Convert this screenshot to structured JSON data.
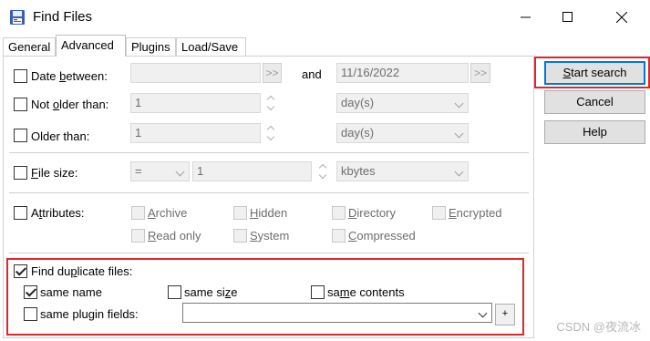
{
  "window": {
    "title": "Find Files"
  },
  "tabs": [
    "General",
    "Advanced",
    "Plugins",
    "Load/Save"
  ],
  "date": {
    "between_label_pre": "Date ",
    "between_label_u": "b",
    "between_label_post": "etween:",
    "from_value": "",
    "range_button": ">>",
    "and_label": "and",
    "to_value": "11/16/2022",
    "range_button2": ">>"
  },
  "not_older": {
    "label_pre": "Not ",
    "label_u": "o",
    "label_post": "lder than:",
    "value": "1",
    "unit": "day(s)"
  },
  "older": {
    "label": "Older than:",
    "value": "1",
    "unit": "day(s)"
  },
  "file_size": {
    "label_u": "F",
    "label_post": "ile size:",
    "operator": "=",
    "value": "1",
    "unit": "kbytes"
  },
  "attributes": {
    "label_pre": "A",
    "label_u": "t",
    "label_post": "tributes:",
    "items": [
      {
        "u": "A",
        "rest": "rchive"
      },
      {
        "u": "H",
        "rest": "idden"
      },
      {
        "u": "D",
        "rest": "irectory"
      },
      {
        "u": "E",
        "rest": "ncrypted"
      },
      {
        "u": "R",
        "rest": "ead only"
      },
      {
        "u": "S",
        "rest": "ystem"
      },
      {
        "u": "C",
        "rest": "ompressed"
      }
    ]
  },
  "duplicates": {
    "label_pre": "Find du",
    "label_u": "p",
    "label_post": "licate files:",
    "checked": true,
    "same_name": {
      "label": "same name",
      "checked": true
    },
    "same_size": {
      "label_pre": "same si",
      "label_u": "z",
      "label_post": "e",
      "checked": false
    },
    "same_contents": {
      "label_pre": "sa",
      "label_u": "m",
      "label_post": "e contents",
      "checked": false
    },
    "same_plugin": {
      "label": "same plugin fields:",
      "checked": false,
      "value": "",
      "add_button": "+"
    }
  },
  "buttons": {
    "start_u": "S",
    "start_rest": "tart search",
    "cancel": "Cancel",
    "help": "Help"
  },
  "watermark": "CSDN @夜流冰",
  "colors": {
    "highlight": "#e0262b",
    "accent": "#0078d7"
  }
}
